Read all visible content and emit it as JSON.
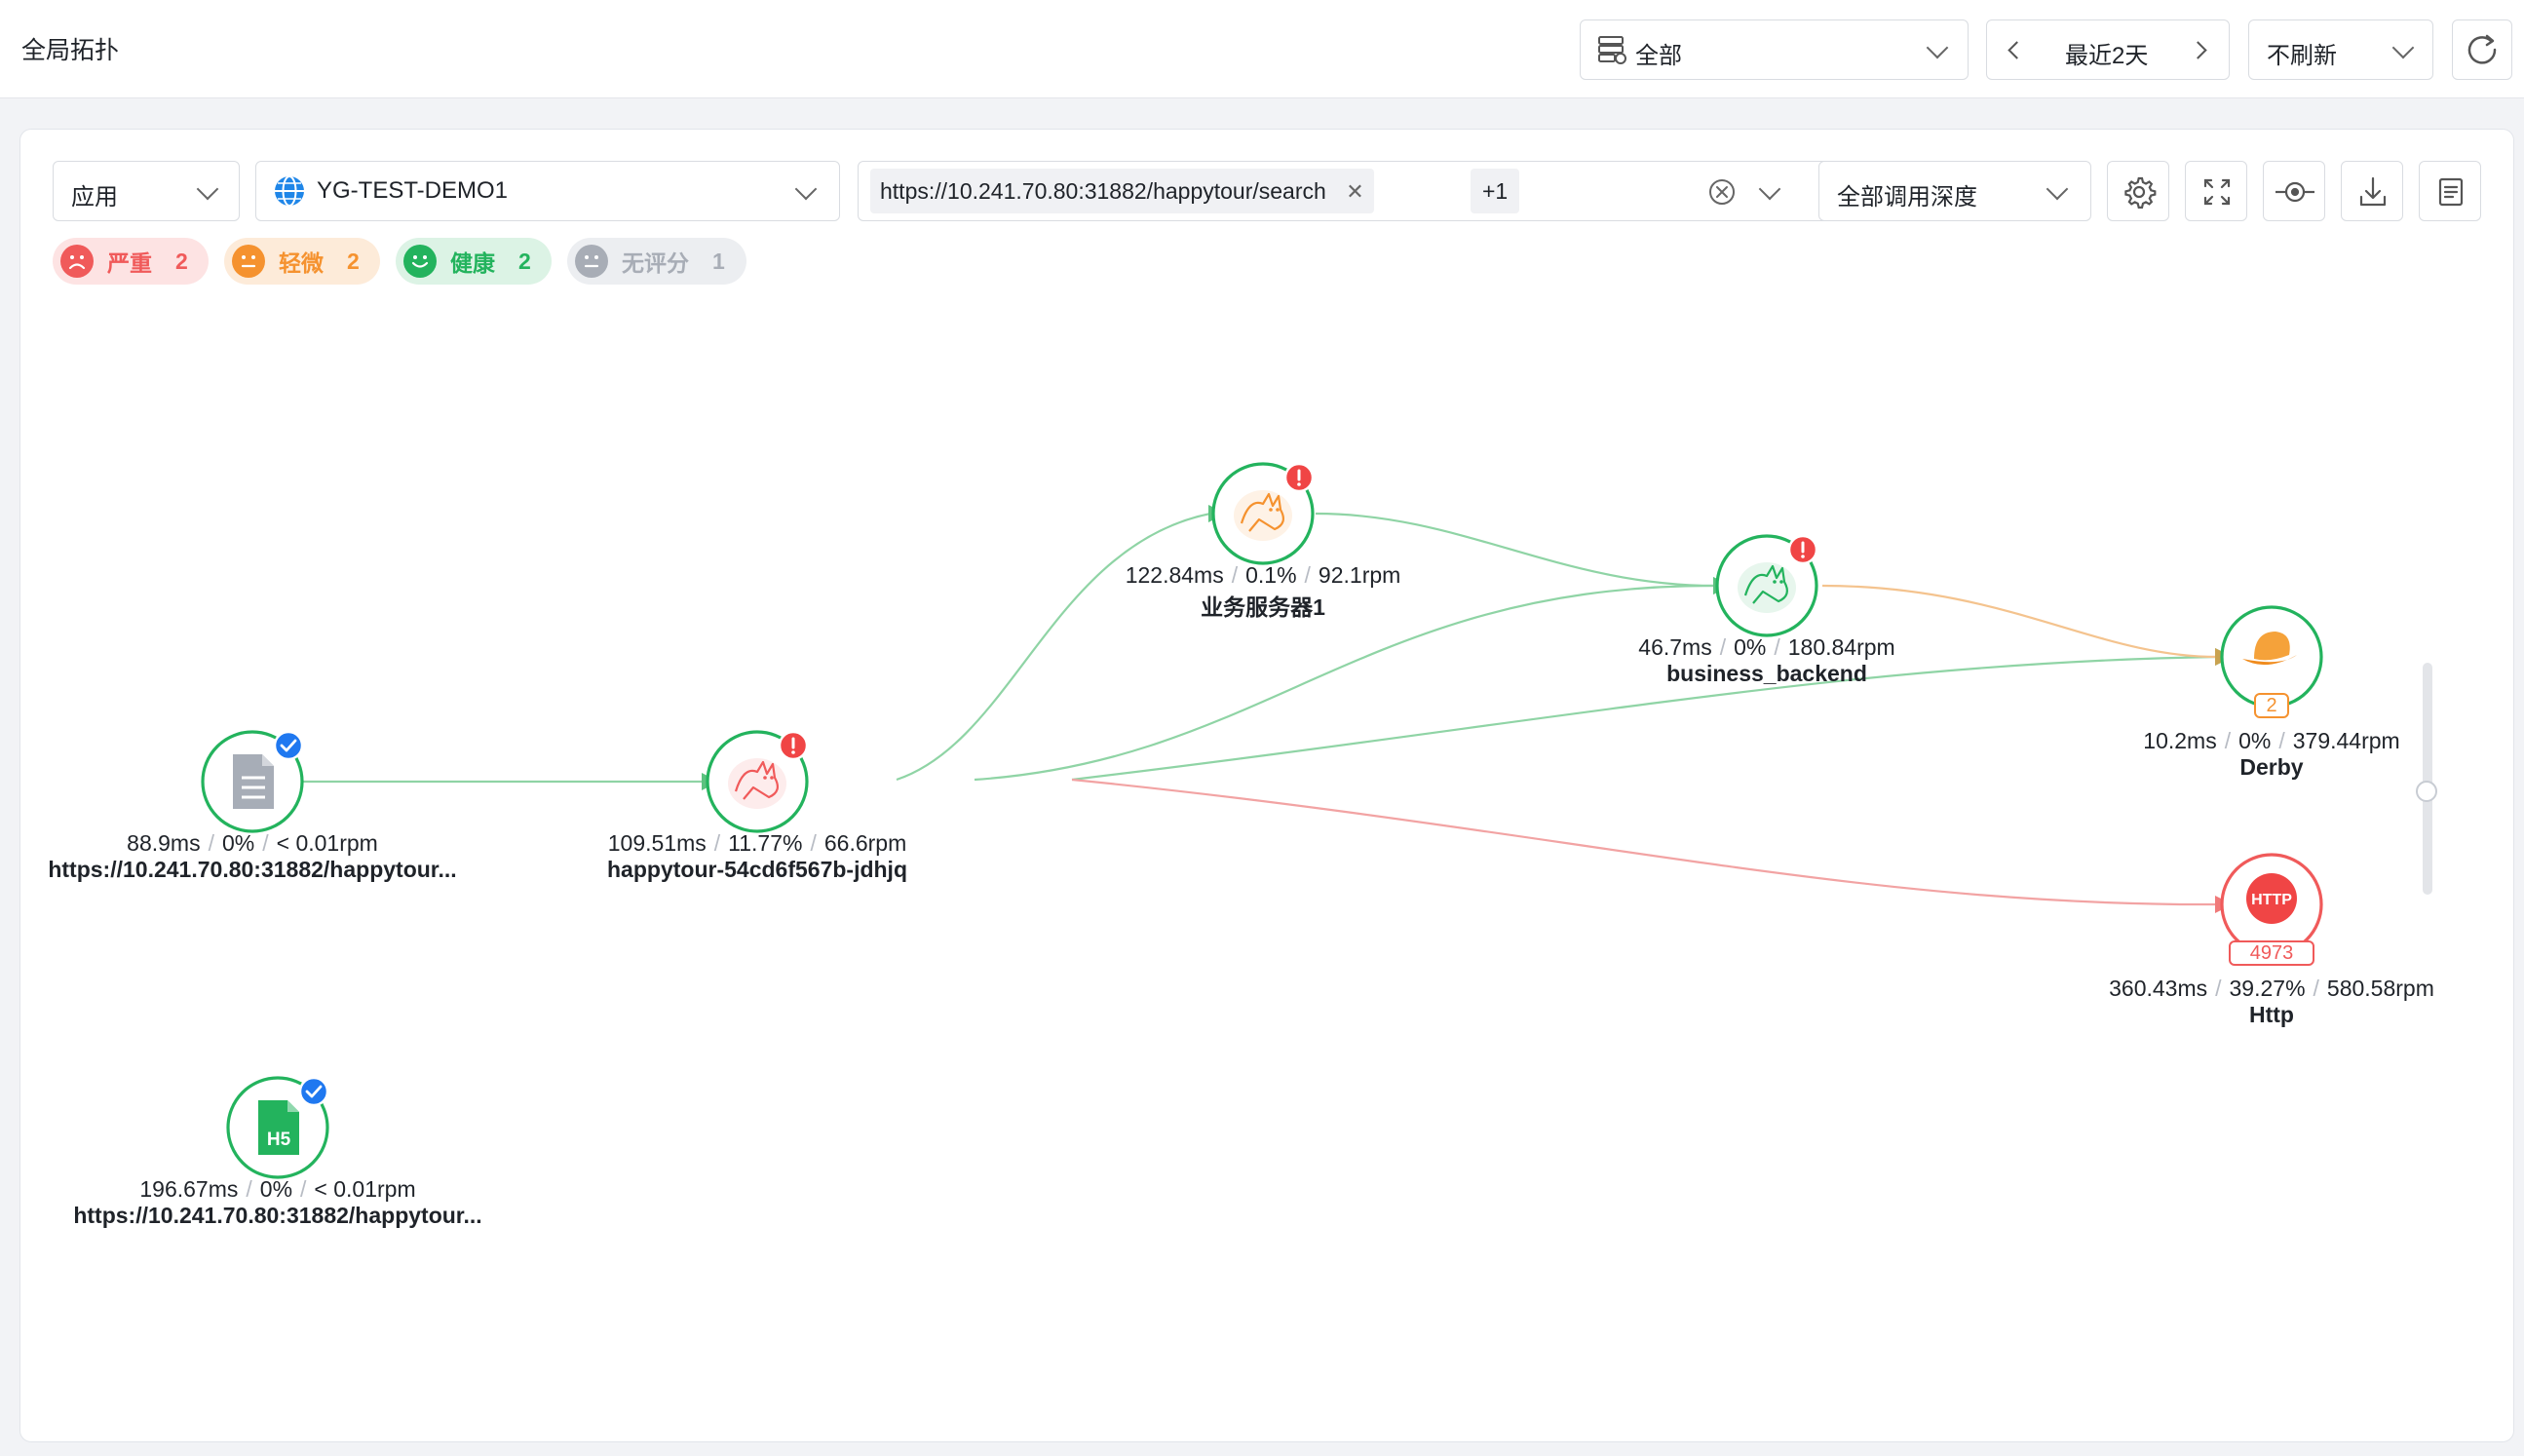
{
  "header": {
    "title": "全局拓扑",
    "env_select": "全部",
    "time_range": "最近2天",
    "refresh_select": "不刷新"
  },
  "toolbar": {
    "type_select": "应用",
    "app_select": "YG-TEST-DEMO1",
    "url_tag": "https://10.241.70.80:31882/happytour/search",
    "url_more": "+1",
    "depth_select": "全部调用深度"
  },
  "legend": [
    {
      "label": "严重",
      "count": "2",
      "color": "#f05a5a",
      "bg": "#fde3e3"
    },
    {
      "label": "轻微",
      "count": "2",
      "color": "#f5922f",
      "bg": "#fdebd9"
    },
    {
      "label": "健康",
      "count": "2",
      "color": "#23b35d",
      "bg": "#dcf3e5"
    },
    {
      "label": "无评分",
      "count": "1",
      "color": "#a8adb6",
      "bg": "#eceef1"
    }
  ],
  "nodes": [
    {
      "id": "n_url",
      "kind": "page-icon",
      "ring": "#23b35d",
      "badge": "check",
      "stats": [
        "88.9ms",
        "0%",
        "< 0.01rpm"
      ],
      "name": "https://10.241.70.80:31882/happytour..."
    },
    {
      "id": "n_h5",
      "kind": "h5-icon",
      "ring": "#23b35d",
      "badge": "check",
      "stats": [
        "196.67ms",
        "0%",
        "< 0.01rpm"
      ],
      "name": "https://10.241.70.80:31882/happytour..."
    },
    {
      "id": "n_happy",
      "kind": "tomcat-icon",
      "ring": "#23b35d",
      "accent": "#f05a5a",
      "badge": "alert",
      "stats": [
        "109.51ms",
        "11.77%",
        "66.6rpm"
      ],
      "name": "happytour-54cd6f567b-jdhjq"
    },
    {
      "id": "n_biz1",
      "kind": "tomcat-icon",
      "ring": "#23b35d",
      "accent": "#f5922f",
      "badge": "alert",
      "stats": [
        "122.84ms",
        "0.1%",
        "92.1rpm"
      ],
      "name": "业务服务器1"
    },
    {
      "id": "n_backend",
      "kind": "tomcat-icon",
      "ring": "#23b35d",
      "accent": "#23b35d",
      "badge": "alert",
      "stats": [
        "46.7ms",
        "0%",
        "180.84rpm"
      ],
      "name": "business_backend"
    },
    {
      "id": "n_derby",
      "kind": "derby-icon",
      "ring": "#23b35d",
      "count": "2",
      "count_color": "#f5922f",
      "stats": [
        "10.2ms",
        "0%",
        "379.44rpm"
      ],
      "name": "Derby"
    },
    {
      "id": "n_http",
      "kind": "http-icon",
      "ring": "#f05a5a",
      "icon_text": "HTTP",
      "count": "4973",
      "count_color": "#f05a5a",
      "stats": [
        "360.43ms",
        "39.27%",
        "580.58rpm"
      ],
      "name": "Http"
    }
  ],
  "edges": [
    {
      "from": "n_url",
      "to": "n_happy",
      "color": "#8fd4a5"
    },
    {
      "from": "n_happy",
      "to": "n_biz1",
      "color": "#8fd4a5"
    },
    {
      "from": "n_happy",
      "to": "n_backend",
      "color": "#8fd4a5"
    },
    {
      "from": "n_happy",
      "to": "n_derby",
      "color": "#8fd4a5"
    },
    {
      "from": "n_happy",
      "to": "n_http",
      "color": "#f2a3a3"
    },
    {
      "from": "n_biz1",
      "to": "n_backend",
      "color": "#8fd4a5"
    },
    {
      "from": "n_backend",
      "to": "n_derby",
      "color": "#f4c38e"
    }
  ]
}
